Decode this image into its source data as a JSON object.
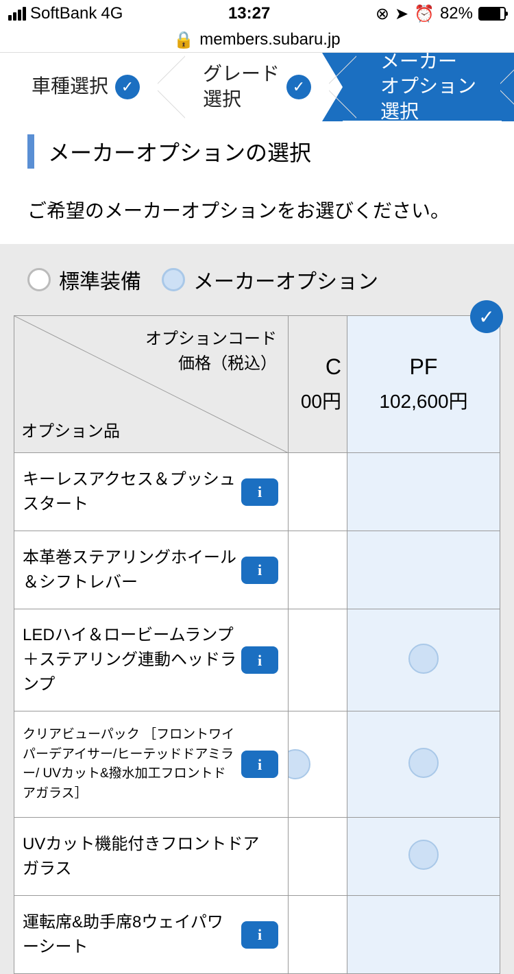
{
  "status": {
    "carrier": "SoftBank",
    "network": "4G",
    "time": "13:27",
    "battery_pct": "82%"
  },
  "url": "members.subaru.jp",
  "steps": {
    "s1": "車種選択",
    "s2": "グレード\n選択",
    "s3": "メーカー\nオプション\n選択"
  },
  "section_title": "メーカーオプションの選択",
  "instruction": "ご希望のメーカーオプションをお選びください。",
  "legend": {
    "standard": "標準装備",
    "option": "メーカーオプション"
  },
  "table": {
    "corner_top1": "オプションコード",
    "corner_top2": "価格（税込）",
    "corner_bottom": "オプション品",
    "col_c_code": "C",
    "col_c_price": "00円",
    "col_pf_code": "PF",
    "col_pf_price": "102,600円",
    "rows": [
      {
        "name": "キーレスアクセス＆プッシュスタート",
        "info": true,
        "c": "",
        "pf": ""
      },
      {
        "name": "本革巻ステアリングホイール＆シフトレバー",
        "info": true,
        "c": "",
        "pf": ""
      },
      {
        "name": "LEDハイ＆ロービームランプ＋ステアリング連動ヘッドランプ",
        "info": true,
        "c": "",
        "pf": "opt"
      },
      {
        "name": "クリアビューパック ［フロントワイパーデアイサー/ヒーテッドドアミラー/ UVカット&撥水加工フロントドアガラス］",
        "info": true,
        "small": true,
        "c": "opt",
        "pf": "opt"
      },
      {
        "name": "UVカット機能付きフロントドアガラス",
        "info": false,
        "c": "",
        "pf": "opt"
      },
      {
        "name": "運転席&助手席8ウェイパワーシート",
        "info": true,
        "c": "",
        "pf": ""
      }
    ]
  }
}
